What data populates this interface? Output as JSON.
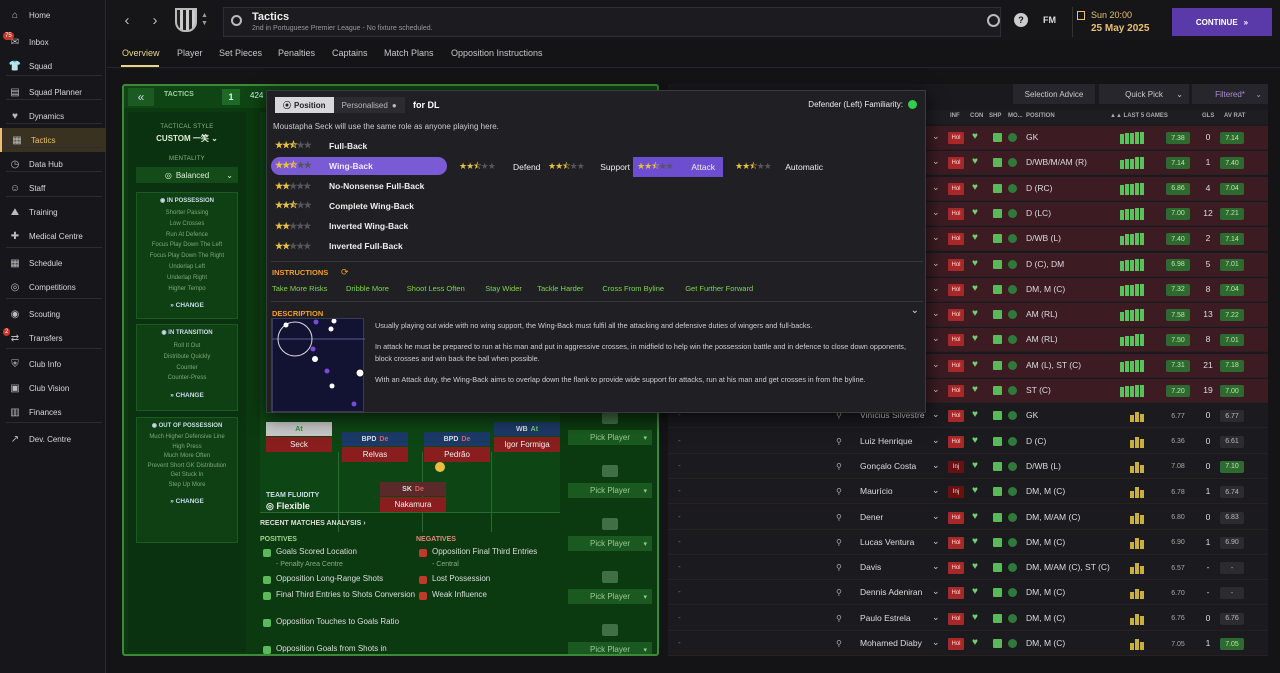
{
  "sidebar": {
    "items": [
      {
        "label": "Home",
        "icon": "home-icon"
      },
      {
        "label": "Inbox",
        "icon": "inbox-icon",
        "badge": "75"
      },
      {
        "label": "Squad",
        "icon": "shirt-icon"
      },
      {
        "label": "Squad Planner",
        "icon": "planner-icon"
      },
      {
        "label": "Dynamics",
        "icon": "dynamics-icon"
      },
      {
        "label": "Tactics",
        "icon": "tactics-icon",
        "active": true
      },
      {
        "label": "Data Hub",
        "icon": "data-hub-icon"
      },
      {
        "label": "Staff",
        "icon": "staff-icon"
      },
      {
        "label": "Training",
        "icon": "training-icon"
      },
      {
        "label": "Medical Centre",
        "icon": "medical-icon"
      },
      {
        "label": "Schedule",
        "icon": "schedule-icon"
      },
      {
        "label": "Competitions",
        "icon": "competitions-icon"
      },
      {
        "label": "Scouting",
        "icon": "scouting-icon"
      },
      {
        "label": "Transfers",
        "icon": "transfers-icon",
        "badge": "2"
      },
      {
        "label": "Club Info",
        "icon": "club-info-icon"
      },
      {
        "label": "Club Vision",
        "icon": "club-vision-icon"
      },
      {
        "label": "Finances",
        "icon": "finances-icon"
      },
      {
        "label": "Dev. Centre",
        "icon": "dev-centre-icon"
      }
    ]
  },
  "header": {
    "title": "Tactics",
    "subtitle": "2nd in Portuguese Premier League - No fixture scheduled.",
    "fm_label": "FM",
    "date_day": "Sun 20:00",
    "date_full": "25 May 2025",
    "continue_label": "CONTINUE"
  },
  "subnav": {
    "tabs": [
      "Overview",
      "Player",
      "Set Pieces",
      "Penalties",
      "Captains",
      "Match Plans",
      "Opposition Instructions"
    ],
    "active": "Overview"
  },
  "tactics_panel": {
    "chip_label": "TACTICS",
    "slot_number": "1",
    "formation_peek": "424",
    "style_label": "TACTICAL STYLE",
    "style_value": "CUSTOM 一笑",
    "mentality_label": "MENTALITY",
    "mentality_value": "Balanced",
    "in_possession": {
      "title": "IN POSSESSION",
      "items": [
        "Shorter Passing",
        "Low Crosses",
        "Run At Defence",
        "Focus Play Down The Left",
        "Focus Play Down The Right",
        "Underlap Left",
        "Underlap Right",
        "Higher Tempo"
      ],
      "change": "CHANGE"
    },
    "in_transition": {
      "title": "IN TRANSITION",
      "items": [
        "Roll It Out",
        "Distribute Quickly",
        "Counter",
        "Counter-Press"
      ],
      "change": "CHANGE"
    },
    "out_of_possession": {
      "title": "OUT OF POSSESSION",
      "items": [
        "Much Higher Defensive Line",
        "High Press",
        "Much More Often",
        "Prevent Short GK Distribution",
        "Get Stuck In",
        "Step Up More"
      ],
      "change": "CHANGE"
    },
    "players": [
      {
        "role": "",
        "duty": "At",
        "name": "Seck"
      },
      {
        "role": "BPD",
        "duty": "De",
        "name": "Relvas"
      },
      {
        "role": "BPD",
        "duty": "De",
        "name": "Pedrão"
      },
      {
        "role": "WB",
        "duty": "At",
        "name": "Igor Formiga"
      },
      {
        "role": "SK",
        "duty": "De",
        "name": "Nakamura"
      }
    ],
    "team_fluidity_label": "TEAM FLUIDITY",
    "team_fluidity_value": "Flexible",
    "pick_player_label": "Pick Player",
    "recent_matches_label": "RECENT MATCHES ANALYSIS",
    "positives_label": "POSITIVES",
    "negatives_label": "NEGATIVES",
    "positives": [
      {
        "text": "Goals Scored Location",
        "sub": "- Penalty Area Centre"
      },
      {
        "text": "Opposition Long-Range Shots",
        "sub": ""
      },
      {
        "text": "Final Third Entries to Shots Conversion",
        "sub": ""
      },
      {
        "text": "Opposition Touches to Goals Ratio",
        "sub": ""
      },
      {
        "text": "Opposition Goals from Shots in",
        "sub": ""
      }
    ],
    "negatives": [
      {
        "text": "Opposition Final Third Entries",
        "sub": "- Central"
      },
      {
        "text": "Lost Possession",
        "sub": ""
      },
      {
        "text": "Weak Influence",
        "sub": ""
      }
    ]
  },
  "squad": {
    "toolbar": {
      "selection_advice": "Selection Advice",
      "quick_pick": "Quick Pick",
      "filtered": "Filtered*"
    },
    "columns": {
      "inf": "INF",
      "con": "CON",
      "shp": "SHP",
      "mo": "MO...",
      "position": "POSITION",
      "last5": "LAST 5 GAMES",
      "gls": "GLS",
      "avrat": "AV RAT"
    },
    "rows": [
      {
        "name": "",
        "inf": "Hol",
        "pos": "GK",
        "form": [
          8,
          9,
          9,
          10,
          10
        ],
        "rating": "7.38",
        "gls": "0",
        "av": "7.14",
        "top": true
      },
      {
        "name": "",
        "inf": "Hol",
        "pos": "D/WB/M/AM (R)",
        "form": [
          8,
          9,
          9,
          10,
          10
        ],
        "rating": "7.14",
        "gls": "1",
        "av": "7.40",
        "top": true
      },
      {
        "name": "",
        "inf": "Hol",
        "pos": "D (RC)",
        "form": [
          8,
          9,
          9,
          10,
          10
        ],
        "rating": "6.86",
        "gls": "4",
        "av": "7.04",
        "top": true
      },
      {
        "name": "",
        "inf": "Hol",
        "pos": "D (LC)",
        "form": [
          8,
          9,
          9,
          10,
          10
        ],
        "rating": "7.00",
        "gls": "12",
        "av": "7.21",
        "top": true
      },
      {
        "name": "",
        "inf": "Hol",
        "pos": "D/WB (L)",
        "form": [
          8,
          9,
          9,
          10,
          10
        ],
        "rating": "7.40",
        "gls": "2",
        "av": "7.14",
        "top": true
      },
      {
        "name": "",
        "inf": "Hol",
        "pos": "D (C), DM",
        "form": [
          8,
          9,
          9,
          10,
          10
        ],
        "rating": "6.98",
        "gls": "5",
        "av": "7.01",
        "top": true
      },
      {
        "name": "",
        "inf": "Hol",
        "pos": "DM, M (C)",
        "form": [
          8,
          9,
          9,
          10,
          10
        ],
        "rating": "7.32",
        "gls": "8",
        "av": "7.04",
        "top": true
      },
      {
        "name": "",
        "inf": "Hol",
        "pos": "AM (RL)",
        "form": [
          8,
          9,
          9,
          10,
          10
        ],
        "rating": "7.58",
        "gls": "13",
        "av": "7.22",
        "top": true
      },
      {
        "name": "",
        "inf": "Hol",
        "pos": "AM (RL)",
        "form": [
          8,
          9,
          9,
          10,
          10
        ],
        "rating": "7.50",
        "gls": "8",
        "av": "7.01",
        "top": true
      },
      {
        "name": "",
        "inf": "Hol",
        "pos": "AM (L), ST (C)",
        "form": [
          8,
          9,
          9,
          10,
          10
        ],
        "rating": "7.31",
        "gls": "21",
        "av": "7.18",
        "top": true
      },
      {
        "name": "",
        "inf": "Hol",
        "pos": "ST (C)",
        "form": [
          8,
          9,
          9,
          10,
          10
        ],
        "rating": "7.20",
        "gls": "19",
        "av": "7.00",
        "top": true
      },
      {
        "name": "Vinícius Silvestre",
        "inf": "Hol",
        "pos": "GK",
        "form": [
          0,
          0,
          6,
          9,
          7
        ],
        "rating": "6.77",
        "gls": "0",
        "av": "6.77",
        "top": false
      },
      {
        "name": "Luiz Henrique",
        "inf": "Hol",
        "pos": "D (C)",
        "form": [
          0,
          0,
          6,
          9,
          7
        ],
        "rating": "6.36",
        "gls": "0",
        "av": "6.61",
        "top": false
      },
      {
        "name": "Gonçalo Costa",
        "inf": "Inj",
        "pos": "D/WB (L)",
        "form": [
          0,
          0,
          6,
          9,
          7
        ],
        "rating": "7.08",
        "gls": "0",
        "av": "7.10",
        "top": false
      },
      {
        "name": "Maurício",
        "inf": "Inj",
        "pos": "DM, M (C)",
        "form": [
          0,
          0,
          6,
          9,
          7
        ],
        "rating": "6.78",
        "gls": "1",
        "av": "6.74",
        "top": false
      },
      {
        "name": "Dener",
        "inf": "Hol",
        "pos": "DM, M/AM (C)",
        "form": [
          0,
          0,
          6,
          9,
          7
        ],
        "rating": "6.80",
        "gls": "0",
        "av": "6.83",
        "top": false
      },
      {
        "name": "Lucas Ventura",
        "inf": "Hol",
        "pos": "DM, M (C)",
        "form": [
          0,
          0,
          6,
          9,
          7
        ],
        "rating": "6.90",
        "gls": "1",
        "av": "6.90",
        "top": false
      },
      {
        "name": "Davis",
        "inf": "Hol",
        "pos": "DM, M/AM (C), ST (C)",
        "form": [
          0,
          0,
          6,
          9,
          7
        ],
        "rating": "6.57",
        "gls": "-",
        "av": "-",
        "top": false
      },
      {
        "name": "Dennis Adeniran",
        "inf": "Hol",
        "pos": "DM, M (C)",
        "form": [
          0,
          0,
          6,
          9,
          7
        ],
        "rating": "6.70",
        "gls": "-",
        "av": "-",
        "top": false
      },
      {
        "name": "Paulo Estrela",
        "inf": "Hol",
        "pos": "DM, M (C)",
        "form": [
          0,
          0,
          6,
          9,
          7
        ],
        "rating": "6.76",
        "gls": "0",
        "av": "6.76",
        "top": false
      },
      {
        "name": "Mohamed Diaby",
        "inf": "Hol",
        "pos": "DM, M (C)",
        "form": [
          0,
          0,
          6,
          9,
          7
        ],
        "rating": "7.05",
        "gls": "1",
        "av": "7.05",
        "top": false
      }
    ]
  },
  "popover": {
    "tab_position": "Position",
    "tab_personalised": "Personalised",
    "for_label": "for DL",
    "familiarity_label": "Defender (Left) Familiarity:",
    "note": "Moustapha Seck will use the same role as anyone playing here.",
    "roles": [
      {
        "label": "Full-Back",
        "stars": 2.5
      },
      {
        "label": "Wing-Back",
        "stars": 2.5,
        "active": true
      },
      {
        "label": "No-Nonsense Full-Back",
        "stars": 2
      },
      {
        "label": "Complete Wing-Back",
        "stars": 2.5
      },
      {
        "label": "Inverted Wing-Back",
        "stars": 2
      },
      {
        "label": "Inverted Full-Back",
        "stars": 2
      }
    ],
    "duties": [
      {
        "label": "Defend",
        "stars": 2.5
      },
      {
        "label": "Support",
        "stars": 2.5
      },
      {
        "label": "Attack",
        "stars": 2.5,
        "active": true
      },
      {
        "label": "Automatic",
        "stars": 2.5
      }
    ],
    "instructions_label": "INSTRUCTIONS",
    "instructions": [
      "Take More Risks",
      "Dribble More",
      "Shoot Less Often",
      "Stay Wider",
      "Tackle Harder",
      "Cross From Byline",
      "Get Further Forward"
    ],
    "description_label": "DESCRIPTION",
    "description": [
      "Usually playing out wide with no wing support, the Wing-Back must fulfil all the attacking and defensive duties of wingers and full-backs.",
      "In attack he must be prepared to run at his man and put in aggressive crosses, in midfield to help win the possession battle and in defence to close down opponents, block crosses and win back the ball when possible.",
      "With an Attack duty, the Wing-Back aims to overlap down the flank to provide wide support for attacks, run at his man and get crosses in from the byline."
    ]
  },
  "colors": {
    "accent": "#6e4ed0",
    "brand_gold": "#e8c070",
    "pitch": "#0c3a10"
  }
}
